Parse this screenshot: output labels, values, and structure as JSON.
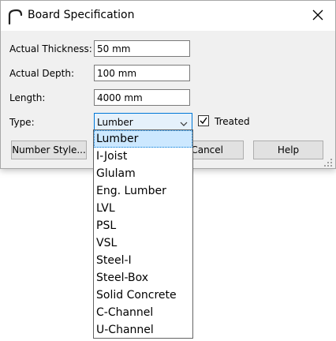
{
  "window": {
    "title": "Board Specification",
    "close_icon": "close-icon",
    "app_icon": "arch-icon"
  },
  "form": {
    "thickness_label": "Actual Thickness:",
    "thickness_value": "50 mm",
    "depth_label": "Actual Depth:",
    "depth_value": "100 mm",
    "length_label": "Length:",
    "length_value": "4000 mm",
    "type_label": "Type:",
    "type_value": "Lumber",
    "treated_label": "Treated",
    "treated_checked": true
  },
  "buttons": {
    "number_style": "Number Style...",
    "cancel": "Cancel",
    "help": "Help"
  },
  "dropdown": {
    "options": [
      "Lumber",
      "I-Joist",
      "Glulam",
      "Eng. Lumber",
      "LVL",
      "PSL",
      "VSL",
      "Steel-I",
      "Steel-Box",
      "Solid Concrete",
      "C-Channel",
      "U-Channel"
    ],
    "selected_index": 0
  },
  "colors": {
    "accent": "#0078d7",
    "selected_bg": "#cce8ff"
  }
}
